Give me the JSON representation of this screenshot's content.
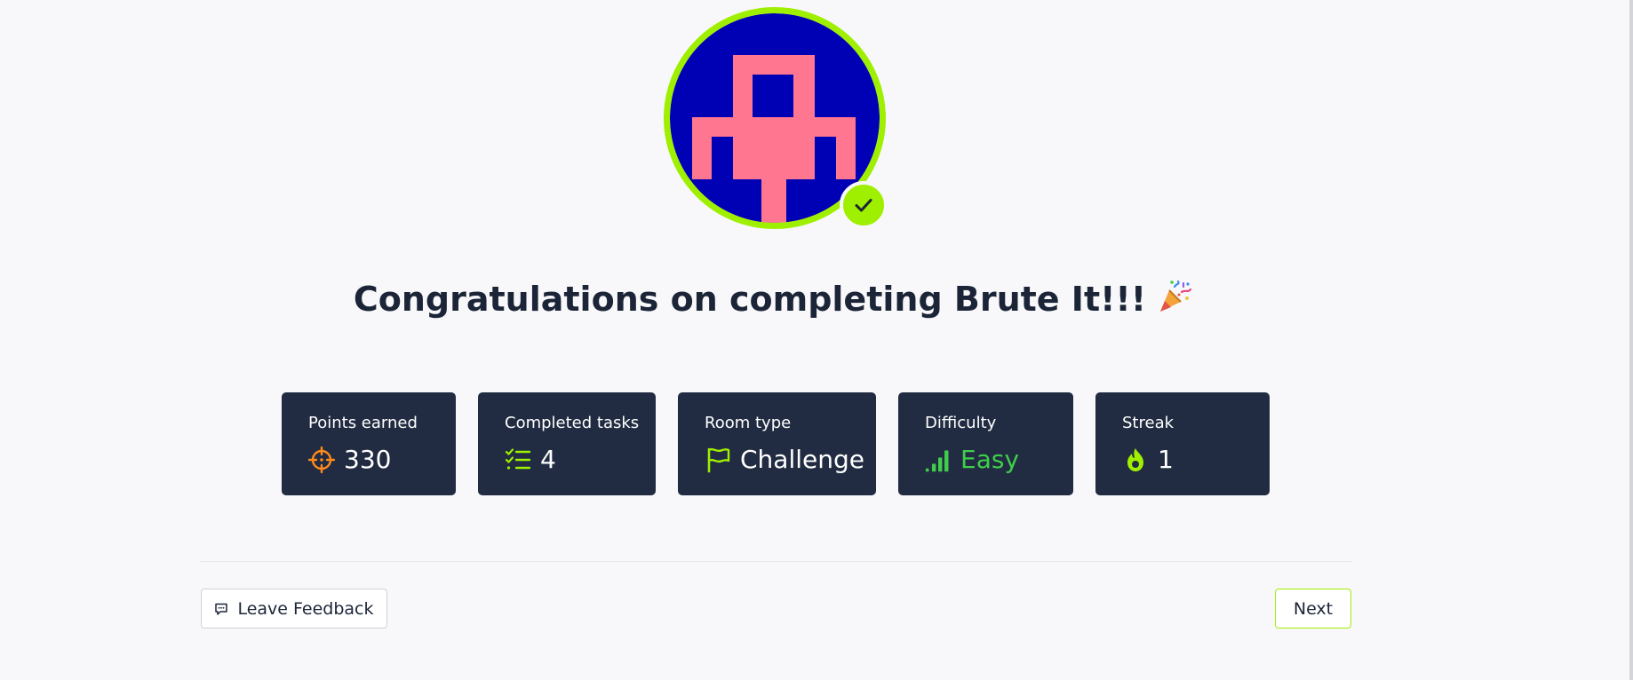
{
  "title": {
    "text": "Congratulations on completing Brute It!!!",
    "emoji": "party-popper-icon"
  },
  "avatar": {
    "icon": "pixel-avatar",
    "colors": {
      "background": "#0000b4",
      "figure": "#fe7690",
      "ring": "#9fef00"
    },
    "badge_icon": "check-icon"
  },
  "stats": [
    {
      "label": "Points earned",
      "value": "330",
      "icon": "crosshair-icon",
      "icon_color": "#ff8a1b"
    },
    {
      "label": "Completed tasks",
      "value": "4",
      "icon": "task-list-icon",
      "icon_color": "#9fef00"
    },
    {
      "label": "Room type",
      "value": "Challenge",
      "icon": "flag-icon",
      "icon_color": "#9fef00"
    },
    {
      "label": "Difficulty",
      "value": "Easy",
      "icon": "signal-bars-icon",
      "icon_color": "#3fcd4b"
    },
    {
      "label": "Streak",
      "value": "1",
      "icon": "flame-icon",
      "icon_color": "#9fef00"
    }
  ],
  "footer": {
    "feedback_label": "Leave Feedback",
    "feedback_icon": "feedback-chat-icon",
    "next_label": "Next"
  },
  "colors": {
    "accent": "#9fef00",
    "card_bg": "#212c42",
    "page_bg": "#f8f8fa",
    "text_dark": "#1c2538"
  }
}
